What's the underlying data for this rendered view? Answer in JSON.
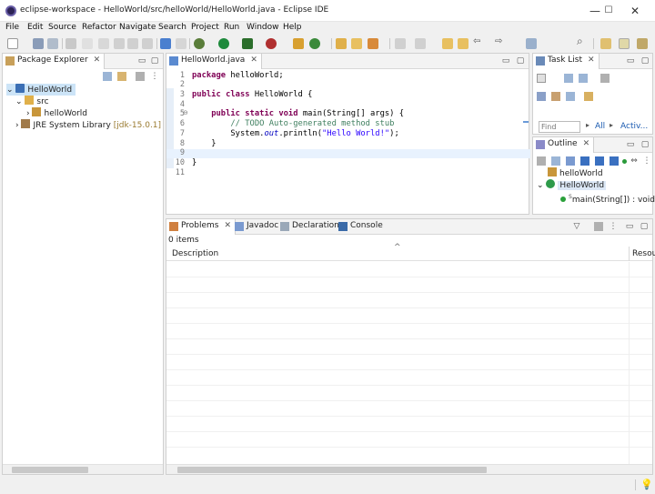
{
  "window": {
    "title": "eclipse-workspace - HelloWorld/src/helloWorld/HelloWorld.java - Eclipse IDE",
    "minimize": "—",
    "maximize": "☐",
    "close": "✕"
  },
  "menu": [
    "File",
    "Edit",
    "Source",
    "Refactor",
    "Navigate",
    "Search",
    "Project",
    "Run",
    "Window",
    "Help"
  ],
  "package_explorer": {
    "tab_label": "Package Explorer",
    "tree": [
      {
        "label": "HelloWorld",
        "icon": "java-project-icon",
        "expanded": true
      },
      {
        "label": "src",
        "icon": "source-folder-icon",
        "expanded": true
      },
      {
        "label": "helloWorld",
        "icon": "package-icon",
        "expanded": false
      },
      {
        "label": "JRE System Library",
        "suffix": "[jdk-15.0.1]",
        "icon": "library-icon",
        "expanded": false
      }
    ]
  },
  "editor": {
    "tab_label": "HelloWorld.java",
    "line_numbers": [
      "1",
      "2",
      "3",
      "4",
      "5",
      "6",
      "7",
      "8",
      "9",
      "10",
      "11"
    ],
    "lines": [
      {
        "kw": "package ",
        "text": "helloWorld;"
      },
      {
        "text": ""
      },
      {
        "kw": "public class ",
        "text": "HelloWorld {"
      },
      {
        "text": ""
      },
      {
        "indent": "    ",
        "kw": "public static void ",
        "text": "main(String[] args) {"
      },
      {
        "indent": "        ",
        "comment": "// TODO Auto-generated method stub"
      },
      {
        "indent": "        ",
        "pre": "System.",
        "field": "out",
        "post": ".println(",
        "string": "\"Hello World!\"",
        "end": ");"
      },
      {
        "indent": "    ",
        "text": "}"
      },
      {
        "text": ""
      },
      {
        "text": "}"
      },
      {
        "text": ""
      }
    ],
    "current_line": 9
  },
  "task_list": {
    "tab_label": "Task List",
    "find_placeholder": "Find",
    "all_label": "All",
    "activate_label": "Activ..."
  },
  "outline": {
    "tab_label": "Outline",
    "items": [
      {
        "label": "helloWorld",
        "icon": "package-icon"
      },
      {
        "label": "HelloWorld",
        "icon": "class-icon"
      },
      {
        "label": "main(String[]) : void",
        "icon": "public-method-icon",
        "modifier": "S"
      }
    ]
  },
  "bottom_tabs": [
    "Problems",
    "Javadoc",
    "Declaration",
    "Console"
  ],
  "problems": {
    "summary": "0 items",
    "columns": [
      "Description",
      "Resou"
    ]
  },
  "colors": {
    "current_line": "#e8f2fe",
    "keyword": "#7f0055",
    "comment": "#3f7f5f",
    "string": "#2a00ff",
    "selection_tab": "#ffffff"
  }
}
